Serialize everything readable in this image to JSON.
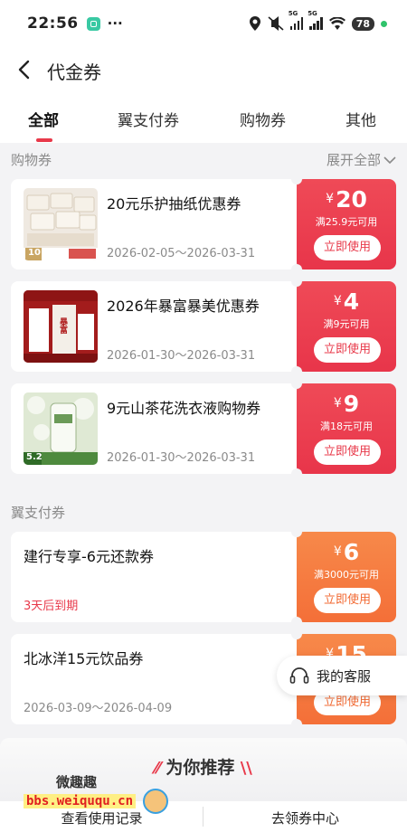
{
  "status_bar": {
    "time": "22:56",
    "more": "···",
    "battery": "78",
    "net1": "5G",
    "net2": "5G"
  },
  "nav": {
    "title": "代金券"
  },
  "tabs": [
    "全部",
    "翼支付券",
    "购物券",
    "其他"
  ],
  "shopping": {
    "heading": "购物券",
    "expand": "展开全部",
    "coupons": [
      {
        "title": "20元乐护抽纸优惠券",
        "date": "2026-02-05～2026-03-31",
        "currency": "¥",
        "amount": "20",
        "condition": "满25.9元可用",
        "button": "立即使用",
        "thumb_text": "10"
      },
      {
        "title": "2026年暴富暴美优惠券",
        "date": "2026-01-30～2026-03-31",
        "currency": "¥",
        "amount": "4",
        "condition": "满9元可用",
        "button": "立即使用",
        "thumb_text": "暴富"
      },
      {
        "title": "9元山茶花洗衣液购物券",
        "date": "2026-01-30～2026-03-31",
        "currency": "¥",
        "amount": "9",
        "condition": "满18元可用",
        "button": "立即使用",
        "thumb_text": "5.2"
      }
    ]
  },
  "yipay": {
    "heading": "翼支付券",
    "coupons": [
      {
        "title": "建行专享-6元还款券",
        "expire": "3天后到期",
        "currency": "¥",
        "amount": "6",
        "condition": "满3000元可用",
        "button": "立即使用"
      },
      {
        "title": "北冰洋15元饮品券",
        "date": "2026-03-09～2026-04-09",
        "currency": "¥",
        "amount": "15",
        "button": "立即使用"
      }
    ]
  },
  "customer_service": "我的客服",
  "recommend": {
    "title_a": "为",
    "title_b": "你推荐"
  },
  "bottom": {
    "left": "查看使用记录",
    "right": "去领券中心"
  },
  "watermark": {
    "line1": "微趣趣",
    "line2": "bbs.weiququ.cn"
  },
  "colors": {
    "accent_red": "#e8394a",
    "accent_orange": "#f46f38"
  }
}
